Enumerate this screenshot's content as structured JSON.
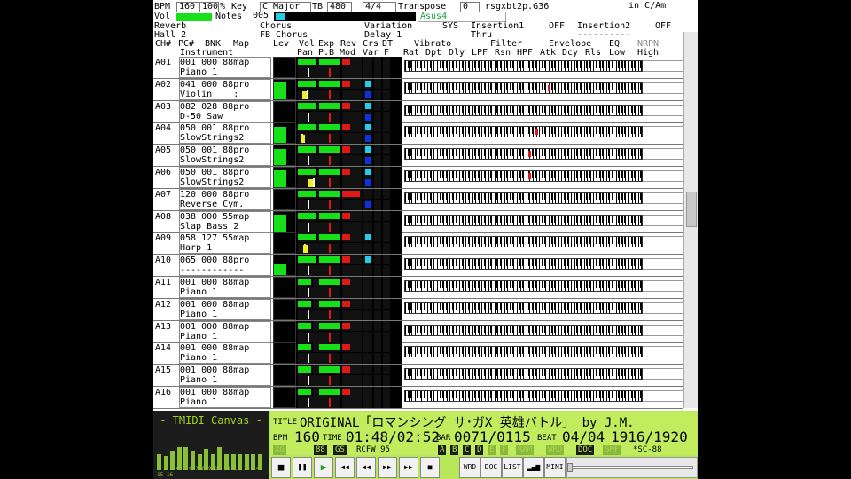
{
  "top": {
    "bpm_label": "BPM",
    "bpm": "160",
    "pct": "100",
    "pct_unit": "%",
    "key_label": "Key",
    "key": "C Major",
    "tb_label": "TB",
    "tb": "480",
    "time_sig": "4/4",
    "transpose_label": "Transpose",
    "transpose": "0",
    "filename": "rsgxbt2p.G36",
    "in_label": "in C/Am",
    "vol_label": "Vol",
    "notes_label": "Notes",
    "notes": "005",
    "chord": "Asus4"
  },
  "effects": {
    "reverb_label": "Reverb",
    "reverb": "Hall 2",
    "chorus_label": "Chorus",
    "chorus": "FB Chorus",
    "variation_label": "Variation",
    "variation_mode": "SYS",
    "variation": "Delay 1",
    "insertion1_label": "Insertion1",
    "insertion1_state": "OFF",
    "insertion1": "Thru",
    "insertion2_label": "Insertion2",
    "insertion2_state": "OFF",
    "insertion2": "----------"
  },
  "columns": {
    "ch": "CH#",
    "pc": "PC#",
    "bnk": "BNK",
    "map": "Map",
    "instrument": "Instrument",
    "lev": "Lev",
    "vol": "Vol",
    "exp": "Exp",
    "rev": "Rev",
    "crs": "Crs",
    "dt": "DT",
    "pan": "Pan",
    "pb": "P.B",
    "mod": "Mod",
    "var": "Var",
    "f": "F",
    "vibrato": "Vibrato",
    "rat": "Rat",
    "dpt": "Dpt",
    "dly": "Dly",
    "filter": "Filter",
    "lpf": "LPF",
    "rsn": "Rsn",
    "hpf": "HPF",
    "envelope": "Envelope",
    "atk": "Atk",
    "dcy": "Dcy",
    "rls": "Rls",
    "eq": "EQ",
    "low": "Low",
    "high": "High",
    "nrpn": "NRPN"
  },
  "channels": [
    {
      "ch": "A01",
      "l1": "001 000 88map",
      "l2": "Piano 1",
      "lev": 0,
      "vol": 0.95,
      "exp": 0.95,
      "pan": 0.5,
      "rev": 0.4,
      "crs": 0,
      "cyan": false,
      "yellow": null,
      "red": null
    },
    {
      "ch": "A02",
      "l1": "041 000 88pro",
      "l2": "Violin    :",
      "lev": 0.85,
      "vol": 0.9,
      "exp": 0.95,
      "pan": 0.45,
      "rev": 0.4,
      "crs": 0.3,
      "cyan": true,
      "yellow": 0.25,
      "red": 0.6
    },
    {
      "ch": "A03",
      "l1": "082 028 88pro",
      "l2": "D-50 Saw",
      "lev": 0,
      "vol": 0.9,
      "exp": 0.95,
      "pan": 0.5,
      "rev": 0.4,
      "crs": 0.3,
      "cyan": true,
      "yellow": null,
      "red": null
    },
    {
      "ch": "A04",
      "l1": "050 001 88pro",
      "l2": "SlowStrings2",
      "lev": 0.85,
      "vol": 0.9,
      "exp": 0.95,
      "pan": 0.2,
      "rev": 0.4,
      "crs": 0.3,
      "cyan": true,
      "yellow": 0.15,
      "red": 0.55
    },
    {
      "ch": "A05",
      "l1": "050 001 88pro",
      "l2": "SlowStrings2",
      "lev": 0.85,
      "vol": 0.9,
      "exp": 0.95,
      "pan": 0.5,
      "rev": 0.4,
      "crs": 0.3,
      "cyan": true,
      "yellow": null,
      "red": 0.52
    },
    {
      "ch": "A06",
      "l1": "050 001 88pro",
      "l2": "SlowStrings2",
      "lev": 0.85,
      "vol": 0.9,
      "exp": 0.95,
      "pan": 0.75,
      "rev": 0.4,
      "crs": 0.3,
      "cyan": true,
      "yellow": 0.6,
      "red": 0.52
    },
    {
      "ch": "A07",
      "l1": "120 000 88pro",
      "l2": "Reverse Cym.",
      "lev": 0,
      "vol": 0.9,
      "exp": 0.95,
      "pan": 0.5,
      "rev": 0.9,
      "crs": 0.3,
      "cyan": false,
      "yellow": null,
      "red": null
    },
    {
      "ch": "A08",
      "l1": "038 000 55map",
      "l2": "Slap Bass 2",
      "lev": 0.85,
      "vol": 0.9,
      "exp": 0.95,
      "pan": 0.5,
      "rev": 0.4,
      "crs": 0,
      "cyan": false,
      "yellow": null,
      "red": null
    },
    {
      "ch": "A09",
      "l1": "058 127 55map",
      "l2": "Harp 1",
      "lev": 0,
      "vol": 0.9,
      "exp": 0.95,
      "pan": 0.3,
      "rev": 0.4,
      "crs": 0,
      "cyan": true,
      "yellow": 0.3,
      "red": null
    },
    {
      "ch": "A10",
      "l1": "065 000 88pro",
      "l2": "------------",
      "lev": 0.55,
      "vol": 0.9,
      "exp": 0.95,
      "pan": 0.5,
      "rev": 0.4,
      "crs": 0,
      "cyan": true,
      "yellow": null,
      "red": null
    },
    {
      "ch": "A11",
      "l1": "001 000 88map",
      "l2": "Piano 1",
      "lev": 0,
      "vol": 0.7,
      "exp": 0.95,
      "pan": 0.5,
      "rev": 0.4,
      "crs": 0,
      "cyan": false,
      "yellow": null,
      "red": null
    },
    {
      "ch": "A12",
      "l1": "001 000 88map",
      "l2": "Piano 1",
      "lev": 0,
      "vol": 0.7,
      "exp": 0.95,
      "pan": 0.5,
      "rev": 0.4,
      "crs": 0,
      "cyan": false,
      "yellow": null,
      "red": null
    },
    {
      "ch": "A13",
      "l1": "001 000 88map",
      "l2": "Piano 1",
      "lev": 0,
      "vol": 0.7,
      "exp": 0.95,
      "pan": 0.5,
      "rev": 0.4,
      "crs": 0,
      "cyan": false,
      "yellow": null,
      "red": null
    },
    {
      "ch": "A14",
      "l1": "001 000 88map",
      "l2": "Piano 1",
      "lev": 0,
      "vol": 0.7,
      "exp": 0.95,
      "pan": 0.5,
      "rev": 0.4,
      "crs": 0,
      "cyan": false,
      "yellow": null,
      "red": null
    },
    {
      "ch": "A15",
      "l1": "001 000 88map",
      "l2": "Piano 1",
      "lev": 0,
      "vol": 0.7,
      "exp": 0.95,
      "pan": 0.5,
      "rev": 0.4,
      "crs": 0,
      "cyan": false,
      "yellow": null,
      "red": null
    },
    {
      "ch": "A16",
      "l1": "001 000 88map",
      "l2": "Piano 1",
      "lev": 0,
      "vol": 0.7,
      "exp": 0.95,
      "pan": 0.5,
      "rev": 0.4,
      "crs": 0,
      "cyan": false,
      "yellow": null,
      "red": null
    }
  ],
  "logo": {
    "title": "- TMIDI Canvas -",
    "channel_nums": "1 2 3 4 5 6 7 8 9 10 11 12 13 14 15 16",
    "levels": [
      0.2,
      0.15,
      0.3,
      0.4,
      0.4,
      0.3,
      0.2,
      0.35,
      0.2,
      0.4,
      0.2,
      0.2,
      0.2,
      0.2,
      0.2,
      0.2
    ]
  },
  "info": {
    "title_label": "TITLE",
    "title": "ORIGINAL「ロマンシング サ･ガX 英雄バトル」 by J.M.",
    "bpm_label": "BPM",
    "bpm": "160",
    "time_label": "TIME",
    "time": "01:48/02:52",
    "bar_label": "BAR",
    "bar": "0071/0115",
    "beat_label": "BEAT",
    "beat": "04/04",
    "ticks": "1916/1920",
    "ind_xg": "XG",
    "ind_88": "88",
    "ind_gs": "GS",
    "ind_rcfw": "RCFW 95",
    "ind_a": "A",
    "ind_b": "B",
    "ind_c": "C",
    "ind_d": "D",
    "ind_e": "E",
    "ind_f": "F",
    "ind_ram": "RAM",
    "ind_wrd": "WRD",
    "ind_doc": "DOC",
    "ind_smf": "SMF",
    "ind_sc88": "*SC-88"
  },
  "toolbar": {
    "stop": "■",
    "pause": "❚❚",
    "play": "▶",
    "prev": "◀◀",
    "rew": "◀◀",
    "ff": "▶▶",
    "next": "▶▶",
    "wrd": "WRD",
    "doc": "DOC",
    "list": "LIST",
    "bars": "▂▄▆",
    "mini": "MINI"
  },
  "colors": {
    "accent_green": "#b8e85a",
    "level_green": "#18e018",
    "bank_red": "#e01818",
    "cyan": "#20d0e8",
    "blue": "#1030e0",
    "yellow": "#f0f020"
  }
}
